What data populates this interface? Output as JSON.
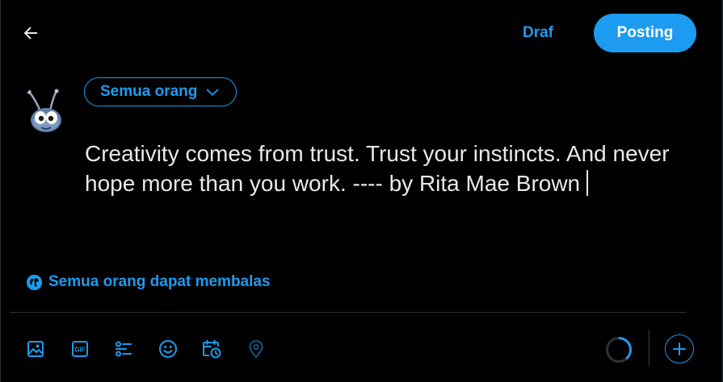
{
  "header": {
    "back_icon": "arrow-left-icon",
    "draft_label": "Draf",
    "post_label": "Posting"
  },
  "audience": {
    "label": "Semua orang",
    "icon": "chevron-down-icon"
  },
  "composer": {
    "text": "Creativity comes from trust. Trust your instincts. And never hope more than you work. ---- by Rita Mae Brown"
  },
  "reply_setting": {
    "label": "Semua orang dapat membalas",
    "icon": "globe-icon"
  },
  "toolbar": {
    "tools": [
      {
        "name": "media",
        "icon": "image-icon"
      },
      {
        "name": "gif",
        "icon": "gif-icon"
      },
      {
        "name": "poll",
        "icon": "poll-icon"
      },
      {
        "name": "emoji",
        "icon": "emoji-icon"
      },
      {
        "name": "schedule",
        "icon": "schedule-icon"
      },
      {
        "name": "location",
        "icon": "location-icon"
      }
    ],
    "character_progress": 0.39
  },
  "colors": {
    "accent": "#1d9bf0",
    "background": "#000000",
    "text": "#e7e9ea",
    "divider": "#2f3336"
  }
}
